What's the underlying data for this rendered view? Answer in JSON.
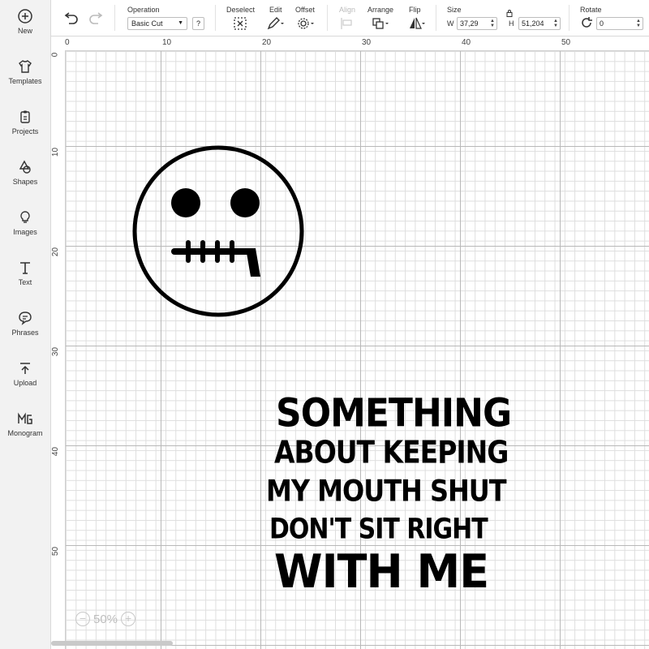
{
  "sidebar": {
    "items": [
      {
        "label": "New",
        "icon": "plus-circle-icon"
      },
      {
        "label": "Templates",
        "icon": "shirt-icon"
      },
      {
        "label": "Projects",
        "icon": "clipboard-icon"
      },
      {
        "label": "Shapes",
        "icon": "shapes-icon"
      },
      {
        "label": "Images",
        "icon": "lightbulb-icon"
      },
      {
        "label": "Text",
        "icon": "text-icon"
      },
      {
        "label": "Phrases",
        "icon": "speech-bubble-icon"
      },
      {
        "label": "Upload",
        "icon": "upload-icon"
      },
      {
        "label": "Monogram",
        "icon": "monogram-icon"
      }
    ]
  },
  "toolbar": {
    "operation_label": "Operation",
    "operation_value": "Basic Cut",
    "help_label": "?",
    "deselect_label": "Deselect",
    "edit_label": "Edit",
    "offset_label": "Offset",
    "align_label": "Align",
    "arrange_label": "Arrange",
    "flip_label": "Flip",
    "size_label": "Size",
    "width_tag": "W",
    "width_value": "37,29",
    "height_tag": "H",
    "height_value": "51,204",
    "rotate_label": "Rotate",
    "rotate_value": "0"
  },
  "rulers": {
    "top": [
      "0",
      "10",
      "20",
      "30",
      "40",
      "50"
    ],
    "left": [
      "0",
      "10",
      "20",
      "30",
      "40",
      "50"
    ]
  },
  "canvas": {
    "quote_lines": [
      "SOMETHING",
      "ABOUT KEEPING",
      "MY MOUTH SHUT",
      "DON'T SIT RIGHT",
      "WITH ME"
    ],
    "zoom_level": "50%",
    "zoom_out_symbol": "−",
    "zoom_in_symbol": "+"
  }
}
